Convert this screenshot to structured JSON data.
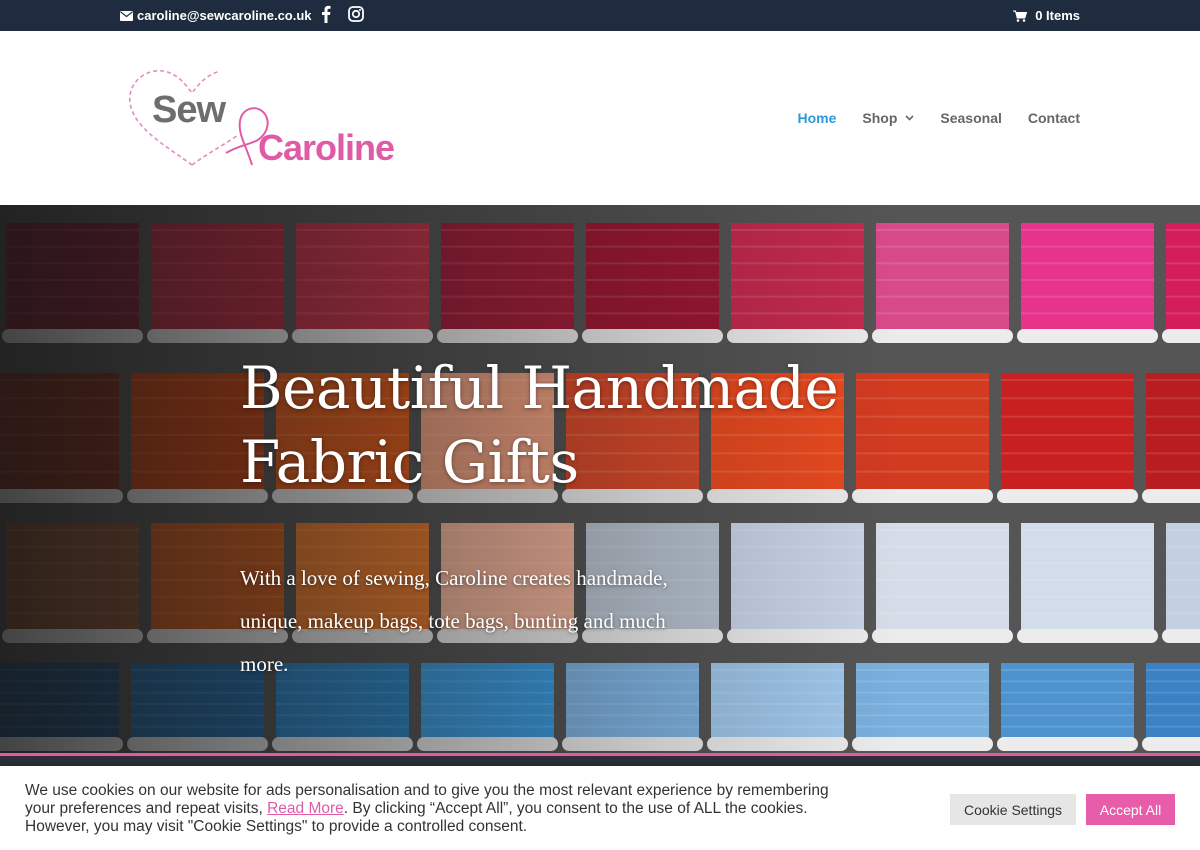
{
  "topbar": {
    "email": "caroline@sewcaroline.co.uk",
    "cart_label": "0 Items"
  },
  "logo": {
    "word1": "Sew",
    "word2": "Caroline"
  },
  "nav": {
    "items": [
      {
        "label": "Home",
        "active": true
      },
      {
        "label": "Shop",
        "has_dropdown": true
      },
      {
        "label": "Seasonal"
      },
      {
        "label": "Contact"
      }
    ]
  },
  "hero": {
    "title_line1": "Beautiful Handmade",
    "title_line2": "Fabric Gifts",
    "subtitle": "With a love of sewing, Caroline creates handmade, unique, makeup bags, tote bags, bunting and much more."
  },
  "cookie": {
    "text_before": "We use cookies on our website for ads personalisation and to give you the most relevant experience by remembering your preferences and repeat visits, ",
    "read_more": "Read More",
    "text_after": ". By clicking “Accept All”, you consent to the use of ALL the cookies. However, you may visit \"Cookie Settings\" to provide a controlled consent.",
    "settings_label": "Cookie Settings",
    "accept_label": "Accept All"
  },
  "colors": {
    "topbar_bg": "#1f2c3f",
    "accent_pink": "#e05ba6",
    "nav_active": "#2e9ad8"
  },
  "icons": [
    "envelope-icon",
    "facebook-icon",
    "instagram-icon",
    "cart-icon",
    "chevron-down-icon"
  ]
}
